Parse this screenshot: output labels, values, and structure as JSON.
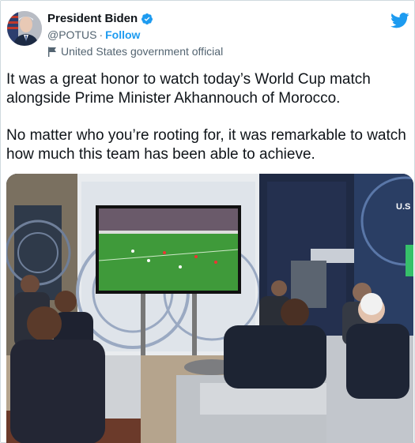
{
  "tweet": {
    "author_name": "President Biden",
    "handle": "@POTUS",
    "separator": "·",
    "follow_label": "Follow",
    "label_text": "United States government official",
    "text_paragraph_1": "It was a great honor to watch today’s World Cup match alongside Prime Minister Akhannouch of Morocco.",
    "text_paragraph_2": "No matter who you’re rooting for, it was remarkable to watch how much this team has been able to achieve."
  },
  "icons": {
    "verified": "verified-badge-icon",
    "government_label": "flag-icon",
    "brand": "twitter-bird-icon"
  },
  "photo": {
    "banner_text": "U.S LEA"
  },
  "colors": {
    "accent": "#1d9bf0",
    "text_primary": "#0f1419",
    "text_secondary": "#536471",
    "border": "#cfd9de"
  }
}
